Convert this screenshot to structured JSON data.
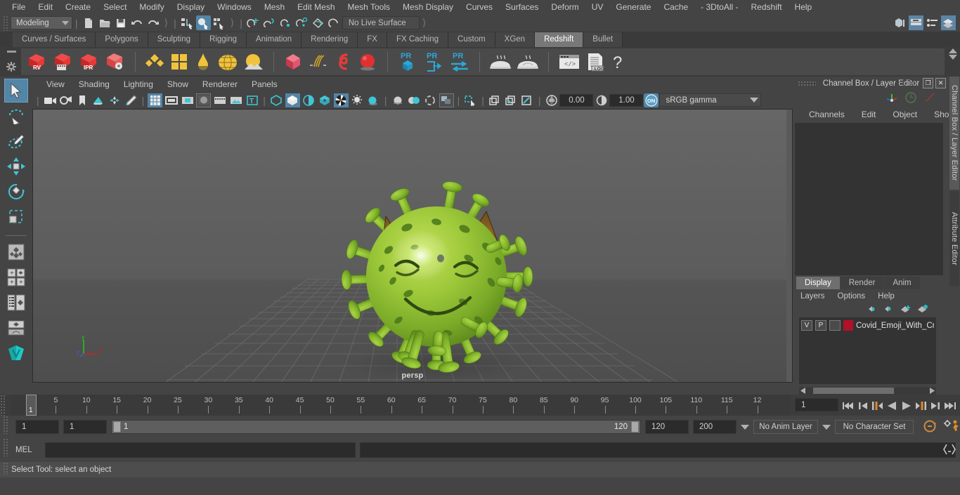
{
  "menubar": {
    "items": [
      "File",
      "Edit",
      "Create",
      "Select",
      "Modify",
      "Display",
      "Windows",
      "Mesh",
      "Edit Mesh",
      "Mesh Tools",
      "Mesh Display",
      "Curves",
      "Surfaces",
      "Deform",
      "UV",
      "Generate",
      "Cache",
      "- 3DtoAll -",
      "Redshift",
      "Help"
    ]
  },
  "statusline": {
    "menuset": "Modeling",
    "live_surface": "No Live Surface"
  },
  "shelf": {
    "tabs": [
      "Curves / Surfaces",
      "Polygons",
      "Sculpting",
      "Rigging",
      "Animation",
      "Rendering",
      "FX",
      "FX Caching",
      "Custom",
      "XGen",
      "Redshift",
      "Bullet"
    ],
    "active_tab": "Redshift",
    "buttons": [
      "rv-render-view",
      "render-sequence",
      "ipr-render",
      "render-settings",
      "material-nodes",
      "texture-grid",
      "ramp-light",
      "dome-light",
      "sun-sky",
      "proxy-cube",
      "hair-strands",
      "spline-curve",
      "sphere-light",
      "pr-proxy-cube",
      "pr-proxy-export",
      "pr-proxy-convert",
      "bake-set-1",
      "bake-set-2",
      "shader-code",
      "log-file",
      "help-question"
    ]
  },
  "viewport_menu": {
    "items": [
      "View",
      "Shading",
      "Lighting",
      "Show",
      "Renderer",
      "Panels"
    ]
  },
  "viewport_toolbar": {
    "exposure": "0.00",
    "gamma_value": "1.00",
    "color_space": "sRGB gamma"
  },
  "viewport": {
    "camera_label": "persp",
    "axes": {
      "x": "x",
      "y": "y",
      "z": "z"
    },
    "model_name": "Covid Emoji With Crown"
  },
  "left_toolbar": {
    "tools": [
      "select-tool",
      "lasso-select-tool",
      "paint-select-tool",
      "move-tool",
      "rotate-tool",
      "scale-tool",
      "last-tool-used",
      "snap-grid",
      "snap-curve",
      "snap-point",
      "snap-view",
      "show-manipulator",
      "outliner-persp-layout",
      "persp-layout",
      "four-view-layout",
      "hypershade-layout"
    ]
  },
  "right_panel": {
    "title": "Channel Box / Layer Editor",
    "channel_tabs": [
      "Channels",
      "Edit",
      "Object",
      "Show"
    ],
    "layer_tabs": [
      "Display",
      "Render",
      "Anim"
    ],
    "active_layer_tab": "Display",
    "layer_menu": [
      "Layers",
      "Options",
      "Help"
    ],
    "layers": [
      {
        "visibility": "V",
        "playback": "P",
        "template": "",
        "color": "#b0112b",
        "name": "Covid_Emoji_With_Cro"
      }
    ],
    "side_tabs": [
      "Channel Box / Layer Editor",
      "Attribute Editor"
    ]
  },
  "timeline": {
    "ticks": [
      "5",
      "10",
      "15",
      "20",
      "25",
      "30",
      "35",
      "40",
      "45",
      "50",
      "55",
      "60",
      "65",
      "70",
      "75",
      "80",
      "85",
      "90",
      "95",
      "100",
      "105",
      "110",
      "115",
      "12"
    ],
    "current_frame_marker": "1",
    "current_frame_field": "1",
    "playback_buttons": [
      "go-to-start",
      "step-back-key",
      "step-back-frame",
      "play-backwards",
      "play-forwards",
      "step-forward-frame",
      "step-forward-key",
      "go-to-end"
    ]
  },
  "range": {
    "anim_start": "1",
    "range_start": "1",
    "slider_min": "1",
    "slider_max": "120",
    "range_end": "120",
    "anim_end": "200",
    "anim_layer": "No Anim Layer",
    "character_set": "No Character Set"
  },
  "command_line": {
    "label": "MEL",
    "input_value": "",
    "output_value": ""
  },
  "status_bar": {
    "message": "Select Tool: select an object"
  }
}
